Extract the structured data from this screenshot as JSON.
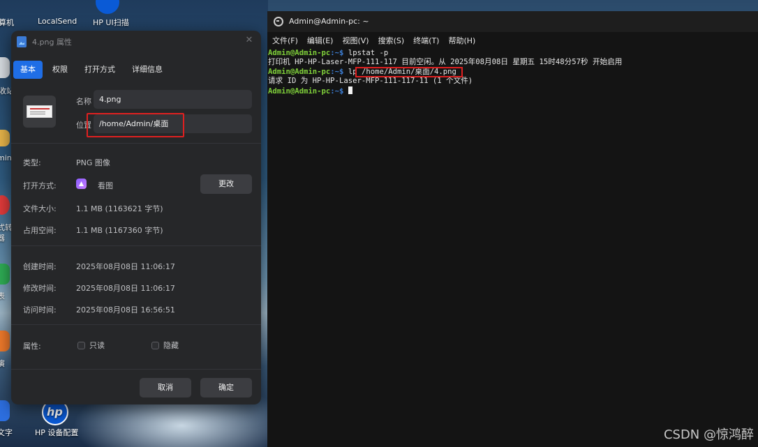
{
  "desktop": {
    "icons": [
      {
        "label": "算机"
      },
      {
        "label": "LocalSend"
      },
      {
        "label": "HP UI扫描"
      },
      {
        "label": "收站"
      },
      {
        "label": "min"
      },
      {
        "label": "式转"
      },
      {
        "label": "器"
      },
      {
        "label": "表"
      },
      {
        "label": "演"
      },
      {
        "label": "文字"
      },
      {
        "label": "HP 设备配置"
      }
    ],
    "hp_logo_text": "hp"
  },
  "dialog": {
    "title": "4.png 属性",
    "tabs": [
      "基本",
      "权限",
      "打开方式",
      "详细信息"
    ],
    "name_label": "名称",
    "name_value": "4.png",
    "location_label": "位置",
    "location_value": "/home/Admin/桌面",
    "type_label": "类型:",
    "type_value": "PNG 图像",
    "open_with_label": "打开方式:",
    "open_with_value": "看图",
    "change_button": "更改",
    "file_size_label": "文件大小:",
    "file_size_value": "1.1 MB (1163621 字节)",
    "disk_usage_label": "占用空间:",
    "disk_usage_value": "1.1 MB (1167360 字节)",
    "created_label": "创建时间:",
    "created_value": "2025年08月08日 11:06:17",
    "modified_label": "修改时间:",
    "modified_value": "2025年08月08日 11:06:17",
    "accessed_label": "访问时间:",
    "accessed_value": "2025年08月08日 16:56:51",
    "attributes_label": "属性:",
    "readonly_label": "只读",
    "hidden_label": "隐藏",
    "cancel_button": "取消",
    "ok_button": "确定"
  },
  "terminal": {
    "title": "Admin@Admin-pc: ~",
    "menu": [
      "文件(F)",
      "编辑(E)",
      "视图(V)",
      "搜索(S)",
      "终端(T)",
      "帮助(H)"
    ],
    "lines": {
      "l1_prompt": "Admin@Admin-pc",
      "l1_path": ":~$",
      "l1_cmd": " lpstat -p",
      "l2": "打印机 HP-HP-Laser-MFP-111-117 目前空闲。从 2025年08月08日 星期五 15时48分57秒 开始启用",
      "l3_prompt": "Admin@Admin-pc",
      "l3_path": ":~$",
      "l3_cmd": " lp /home/Admin/桌面/4.png",
      "l4": "请求 ID 为 HP-HP-Laser-MFP-111-117-11 (1 个文件)",
      "l5_prompt": "Admin@Admin-pc",
      "l5_path": ":~$"
    }
  },
  "watermark": "CSDN @惊鸿醉",
  "colors": {
    "accent": "#1f6ee6",
    "highlight": "#e02020",
    "prompt_green": "#7fcf3a",
    "path_blue": "#3d7fd6"
  }
}
